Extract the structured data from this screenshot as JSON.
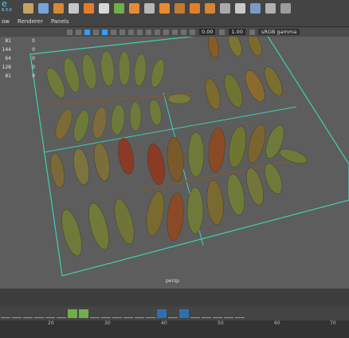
{
  "logo": {
    "version": "6.3.0"
  },
  "menu": [
    "ow",
    "Renderer",
    "Panels"
  ],
  "viewport_toolbar": {
    "exposure": "0.00",
    "gamma": "1.00",
    "color_space": "sRGB gamma"
  },
  "hud_rows": [
    {
      "a": "81",
      "b": "0"
    },
    {
      "a": "144",
      "b": "0"
    },
    {
      "a": "64",
      "b": "0"
    },
    {
      "a": "128",
      "b": "0"
    },
    {
      "a": "81",
      "b": "0"
    }
  ],
  "camera": "persp",
  "timeline": {
    "ticks": [
      "20",
      "30",
      "40",
      "50",
      "60",
      "70"
    ]
  },
  "colors": {
    "accent": "#2f9fff",
    "grid": "#3fd0b0",
    "leaf_green": "#6e7a3a",
    "leaf_red": "#8a3a25"
  }
}
